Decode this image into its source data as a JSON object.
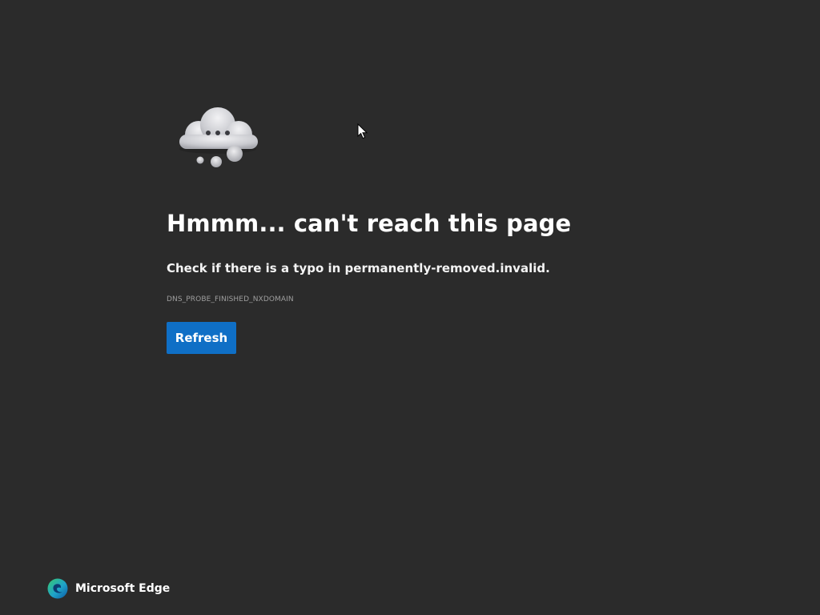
{
  "error_page": {
    "illustration": "cloud-thinking-icon",
    "title": "Hmmm... can't reach this page",
    "message": "Check if there is a typo in permanently-removed.invalid.",
    "error_code": "DNS_PROBE_FINISHED_NXDOMAIN",
    "refresh_label": "Refresh"
  },
  "branding": {
    "logo_icon": "edge-logo-icon",
    "name": "Microsoft Edge"
  },
  "colors": {
    "background": "#2b2b2b",
    "accent": "#0f6fc6",
    "text": "#ffffff",
    "muted_text": "#9e9e9e"
  }
}
